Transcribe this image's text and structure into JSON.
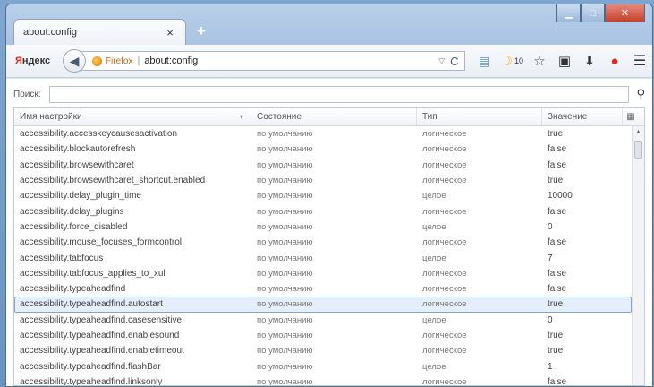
{
  "tab": {
    "title": "about:config",
    "close": "×",
    "new_tab": "+"
  },
  "window_controls": {
    "minimize": "▁",
    "maximize": "□",
    "close": "✕"
  },
  "toolbar": {
    "yandex_first": "Я",
    "yandex_rest": "ндекс",
    "back": "◀",
    "firefox_label": "Firefox",
    "url_separator": "|",
    "url": "about:config",
    "dropdown": "▽",
    "reload": "C",
    "moon_count": "10",
    "icons": [
      "card-icon",
      "moon-icon",
      "star-icon",
      "clipboard-icon",
      "download-icon",
      "alert-icon",
      "menu-icon"
    ]
  },
  "search": {
    "label": "Поиск:",
    "value": "",
    "icon": "⚲"
  },
  "table": {
    "columns": [
      "Имя настройки",
      "Состояние",
      "Тип",
      "Значение"
    ],
    "rows": [
      [
        "accessibility.accesskeycausesactivation",
        "по умолчанию",
        "логическое",
        "true"
      ],
      [
        "accessibility.blockautorefresh",
        "по умолчанию",
        "логическое",
        "false"
      ],
      [
        "accessibility.browsewithcaret",
        "по умолчанию",
        "логическое",
        "false"
      ],
      [
        "accessibility.browsewithcaret_shortcut.enabled",
        "по умолчанию",
        "логическое",
        "true"
      ],
      [
        "accessibility.delay_plugin_time",
        "по умолчанию",
        "целое",
        "10000"
      ],
      [
        "accessibility.delay_plugins",
        "по умолчанию",
        "логическое",
        "false"
      ],
      [
        "accessibility.force_disabled",
        "по умолчанию",
        "целое",
        "0"
      ],
      [
        "accessibility.mouse_focuses_formcontrol",
        "по умолчанию",
        "логическое",
        "false"
      ],
      [
        "accessibility.tabfocus",
        "по умолчанию",
        "целое",
        "7"
      ],
      [
        "accessibility.tabfocus_applies_to_xul",
        "по умолчанию",
        "логическое",
        "false"
      ],
      [
        "accessibility.typeaheadfind",
        "по умолчанию",
        "логическое",
        "false"
      ],
      [
        "accessibility.typeaheadfind.autostart",
        "по умолчанию",
        "логическое",
        "true"
      ],
      [
        "accessibility.typeaheadfind.casesensitive",
        "по умолчанию",
        "целое",
        "0"
      ],
      [
        "accessibility.typeaheadfind.enablesound",
        "по умолчанию",
        "логическое",
        "true"
      ],
      [
        "accessibility.typeaheadfind.enabletimeout",
        "по умолчанию",
        "логическое",
        "true"
      ],
      [
        "accessibility.typeaheadfind.flashBar",
        "по умолчанию",
        "целое",
        "1"
      ],
      [
        "accessibility.typeaheadfind.linksonly",
        "по умолчанию",
        "логическое",
        "false"
      ]
    ],
    "selected_row": 11
  }
}
